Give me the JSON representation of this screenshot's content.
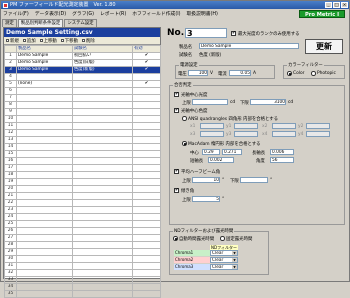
{
  "window": {
    "title": "PM ファーフィールド配光測定装置　Ver. 1.80"
  },
  "menu": [
    "ファイル(F)",
    "データ表示(D)",
    "グラフ(G)",
    "レポート(R)",
    "ホフフィールド作成(I)",
    "取扱説明書(H)"
  ],
  "badge": "Pro Metric I",
  "tabs": [
    "測定",
    "製品別判断条件設定",
    "システム設定"
  ],
  "left": {
    "file_title": "Demo Sample Setting.csv",
    "toolbar": {
      "new": "新規",
      "add": "追加",
      "up": "上移動",
      "down": "下移動",
      "delete": "削除"
    },
    "columns": [
      "",
      "製品名",
      "試験名",
      "有効"
    ],
    "rows": [
      {
        "no": "1",
        "name": "Demo Sample",
        "test": "初回払い",
        "valid": "✔"
      },
      {
        "no": "2",
        "name": "Demo Sample",
        "test": "色度(旧版)",
        "valid": "✔"
      },
      {
        "no": "3",
        "name": "Demo Sample",
        "test": "色度(新版)",
        "valid": "✔"
      },
      {
        "no": "4",
        "name": "",
        "test": "",
        "valid": ""
      },
      {
        "no": "5",
        "name": "(none)",
        "test": "",
        "valid": "✔"
      },
      {
        "no": "6",
        "name": "",
        "test": "",
        "valid": ""
      },
      {
        "no": "7",
        "name": "",
        "test": "",
        "valid": ""
      },
      {
        "no": "8",
        "name": "",
        "test": "",
        "valid": ""
      },
      {
        "no": "9",
        "name": "",
        "test": "",
        "valid": ""
      },
      {
        "no": "10",
        "name": "",
        "test": "",
        "valid": ""
      },
      {
        "no": "11",
        "name": "",
        "test": "",
        "valid": ""
      },
      {
        "no": "12",
        "name": "",
        "test": "",
        "valid": ""
      },
      {
        "no": "13",
        "name": "",
        "test": "",
        "valid": ""
      },
      {
        "no": "14",
        "name": "",
        "test": "",
        "valid": ""
      },
      {
        "no": "15",
        "name": "",
        "test": "",
        "valid": ""
      },
      {
        "no": "16",
        "name": "",
        "test": "",
        "valid": ""
      },
      {
        "no": "17",
        "name": "",
        "test": "",
        "valid": ""
      },
      {
        "no": "18",
        "name": "",
        "test": "",
        "valid": ""
      },
      {
        "no": "19",
        "name": "",
        "test": "",
        "valid": ""
      },
      {
        "no": "20",
        "name": "",
        "test": "",
        "valid": ""
      },
      {
        "no": "21",
        "name": "",
        "test": "",
        "valid": ""
      },
      {
        "no": "22",
        "name": "",
        "test": "",
        "valid": ""
      },
      {
        "no": "23",
        "name": "",
        "test": "",
        "valid": ""
      },
      {
        "no": "24",
        "name": "",
        "test": "",
        "valid": ""
      },
      {
        "no": "25",
        "name": "",
        "test": "",
        "valid": ""
      },
      {
        "no": "26",
        "name": "",
        "test": "",
        "valid": ""
      },
      {
        "no": "27",
        "name": "",
        "test": "",
        "valid": ""
      },
      {
        "no": "28",
        "name": "",
        "test": "",
        "valid": ""
      },
      {
        "no": "29",
        "name": "",
        "test": "",
        "valid": ""
      },
      {
        "no": "30",
        "name": "",
        "test": "",
        "valid": ""
      },
      {
        "no": "31",
        "name": "",
        "test": "",
        "valid": ""
      },
      {
        "no": "32",
        "name": "",
        "test": "",
        "valid": ""
      },
      {
        "no": "33",
        "name": "",
        "test": "",
        "valid": ""
      },
      {
        "no": "34",
        "name": "",
        "test": "",
        "valid": ""
      },
      {
        "no": "35",
        "name": "",
        "test": "",
        "valid": ""
      }
    ]
  },
  "right": {
    "no_label": "No.",
    "no_value": "3",
    "max_lum_label": "最大光度のランクのみ使用する",
    "product_label": "製品名",
    "product_value": "Demo Sample",
    "test_label": "試験名",
    "test_value": "色度 (新版)",
    "update": "更新",
    "power": {
      "title": "電源設定",
      "v_label": "電圧",
      "v_value": "100",
      "v_unit": "V",
      "i_label": "電流",
      "i_value": "0.05",
      "i_unit": "A"
    },
    "filter": {
      "title": "カラーフィルター",
      "color": "Color",
      "photopic": "Photopic"
    },
    "judge": {
      "title": "合否判定",
      "lum_center": "光軸中心光度",
      "upper": "上限",
      "upper_val": "cd",
      "lower": "下限",
      "lower_val": "3100",
      "cd": "cd",
      "chroma_center": "光軸中心色度",
      "ansi": "ANSI quadrangles 四角形 内部を合格とする",
      "x1": "x1",
      "y1": "y1",
      "x2": "x2",
      "y2": "y2",
      "x3": "x3",
      "y3": "y3",
      "x4": "x4",
      "y4": "y4",
      "macadam": "MacAdam 楕円形 内部を合格とする",
      "center_label": "中心",
      "cx": "0.29",
      "cy": "0.271",
      "long_label": "長軸長",
      "long_val": "0.006",
      "short_label": "短軸長",
      "short_val": "0.002",
      "angle_label": "角度",
      "angle_val": "56",
      "halfbeam": "平均ハーフビーム角",
      "hb_upper": "上限",
      "hb_upper_val": "10",
      "deg": "°",
      "hb_lower": "下限",
      "hb_lower_val": "",
      "tilt": "傾き角",
      "tilt_upper": "上限",
      "tilt_upper_val": "5"
    },
    "nd": {
      "title": "NDフィルターおよび露光時間",
      "auto": "自動時間露光時間",
      "manual": "固定露光時間",
      "col_head": "NDフィルター",
      "rows": [
        {
          "label": "Chroma1",
          "value": "Clear"
        },
        {
          "label": "Chroma2",
          "value": "Clear"
        },
        {
          "label": "Chroma3",
          "value": "Clear"
        }
      ]
    }
  }
}
